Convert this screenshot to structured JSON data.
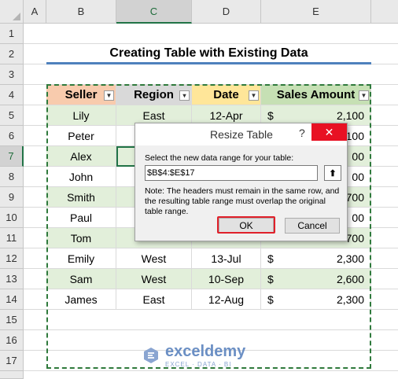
{
  "columns": [
    "A",
    "B",
    "C",
    "D",
    "E"
  ],
  "selected_column": "C",
  "rows": [
    "1",
    "2",
    "3",
    "4",
    "5",
    "6",
    "7",
    "8",
    "9",
    "10",
    "11",
    "12",
    "13",
    "14",
    "15",
    "16",
    "17"
  ],
  "selected_row": "7",
  "title": "Creating Table with Existing Data",
  "headers": {
    "seller": "Seller",
    "region": "Region",
    "date": "Date",
    "amount": "Sales Amount"
  },
  "data_rows": [
    {
      "seller": "Lily",
      "region": "East",
      "date": "12-Apr",
      "dollar": "$",
      "amount": "2,100"
    },
    {
      "seller": "Peter",
      "region": "",
      "date": "",
      "dollar": "",
      "amount": "100"
    },
    {
      "seller": "Alex",
      "region": "",
      "date": "",
      "dollar": "",
      "amount": "00"
    },
    {
      "seller": "John",
      "region": "",
      "date": "",
      "dollar": "",
      "amount": "00"
    },
    {
      "seller": "Smith",
      "region": "",
      "date": "",
      "dollar": "",
      "amount": "700"
    },
    {
      "seller": "Paul",
      "region": "",
      "date": "",
      "dollar": "",
      "amount": "00"
    },
    {
      "seller": "Tom",
      "region": "",
      "date": "",
      "dollar": "",
      "amount": "700"
    },
    {
      "seller": "Emily",
      "region": "West",
      "date": "13-Jul",
      "dollar": "$",
      "amount": "2,300"
    },
    {
      "seller": "Sam",
      "region": "West",
      "date": "10-Sep",
      "dollar": "$",
      "amount": "2,600"
    },
    {
      "seller": "James",
      "region": "East",
      "date": "12-Aug",
      "dollar": "$",
      "amount": "2,300"
    }
  ],
  "dialog": {
    "title": "Resize Table",
    "help": "?",
    "close": "✕",
    "prompt": "Select the new data range for your table:",
    "range": "$B$4:$E$17",
    "note": "Note: The headers must remain in the same row, and the resulting table range must overlap the original table range.",
    "ok": "OK",
    "cancel": "Cancel"
  },
  "watermark": {
    "name": "exceldemy",
    "tagline": "EXCEL · DATA · BI"
  },
  "colors": {
    "accent": "#217346",
    "seller_header": "#f8cbad",
    "region_header": "#d9d9d9",
    "date_header": "#ffe699",
    "amount_header": "#c6e0b4",
    "band": "#e2efda",
    "highlight": "#e0202a"
  }
}
